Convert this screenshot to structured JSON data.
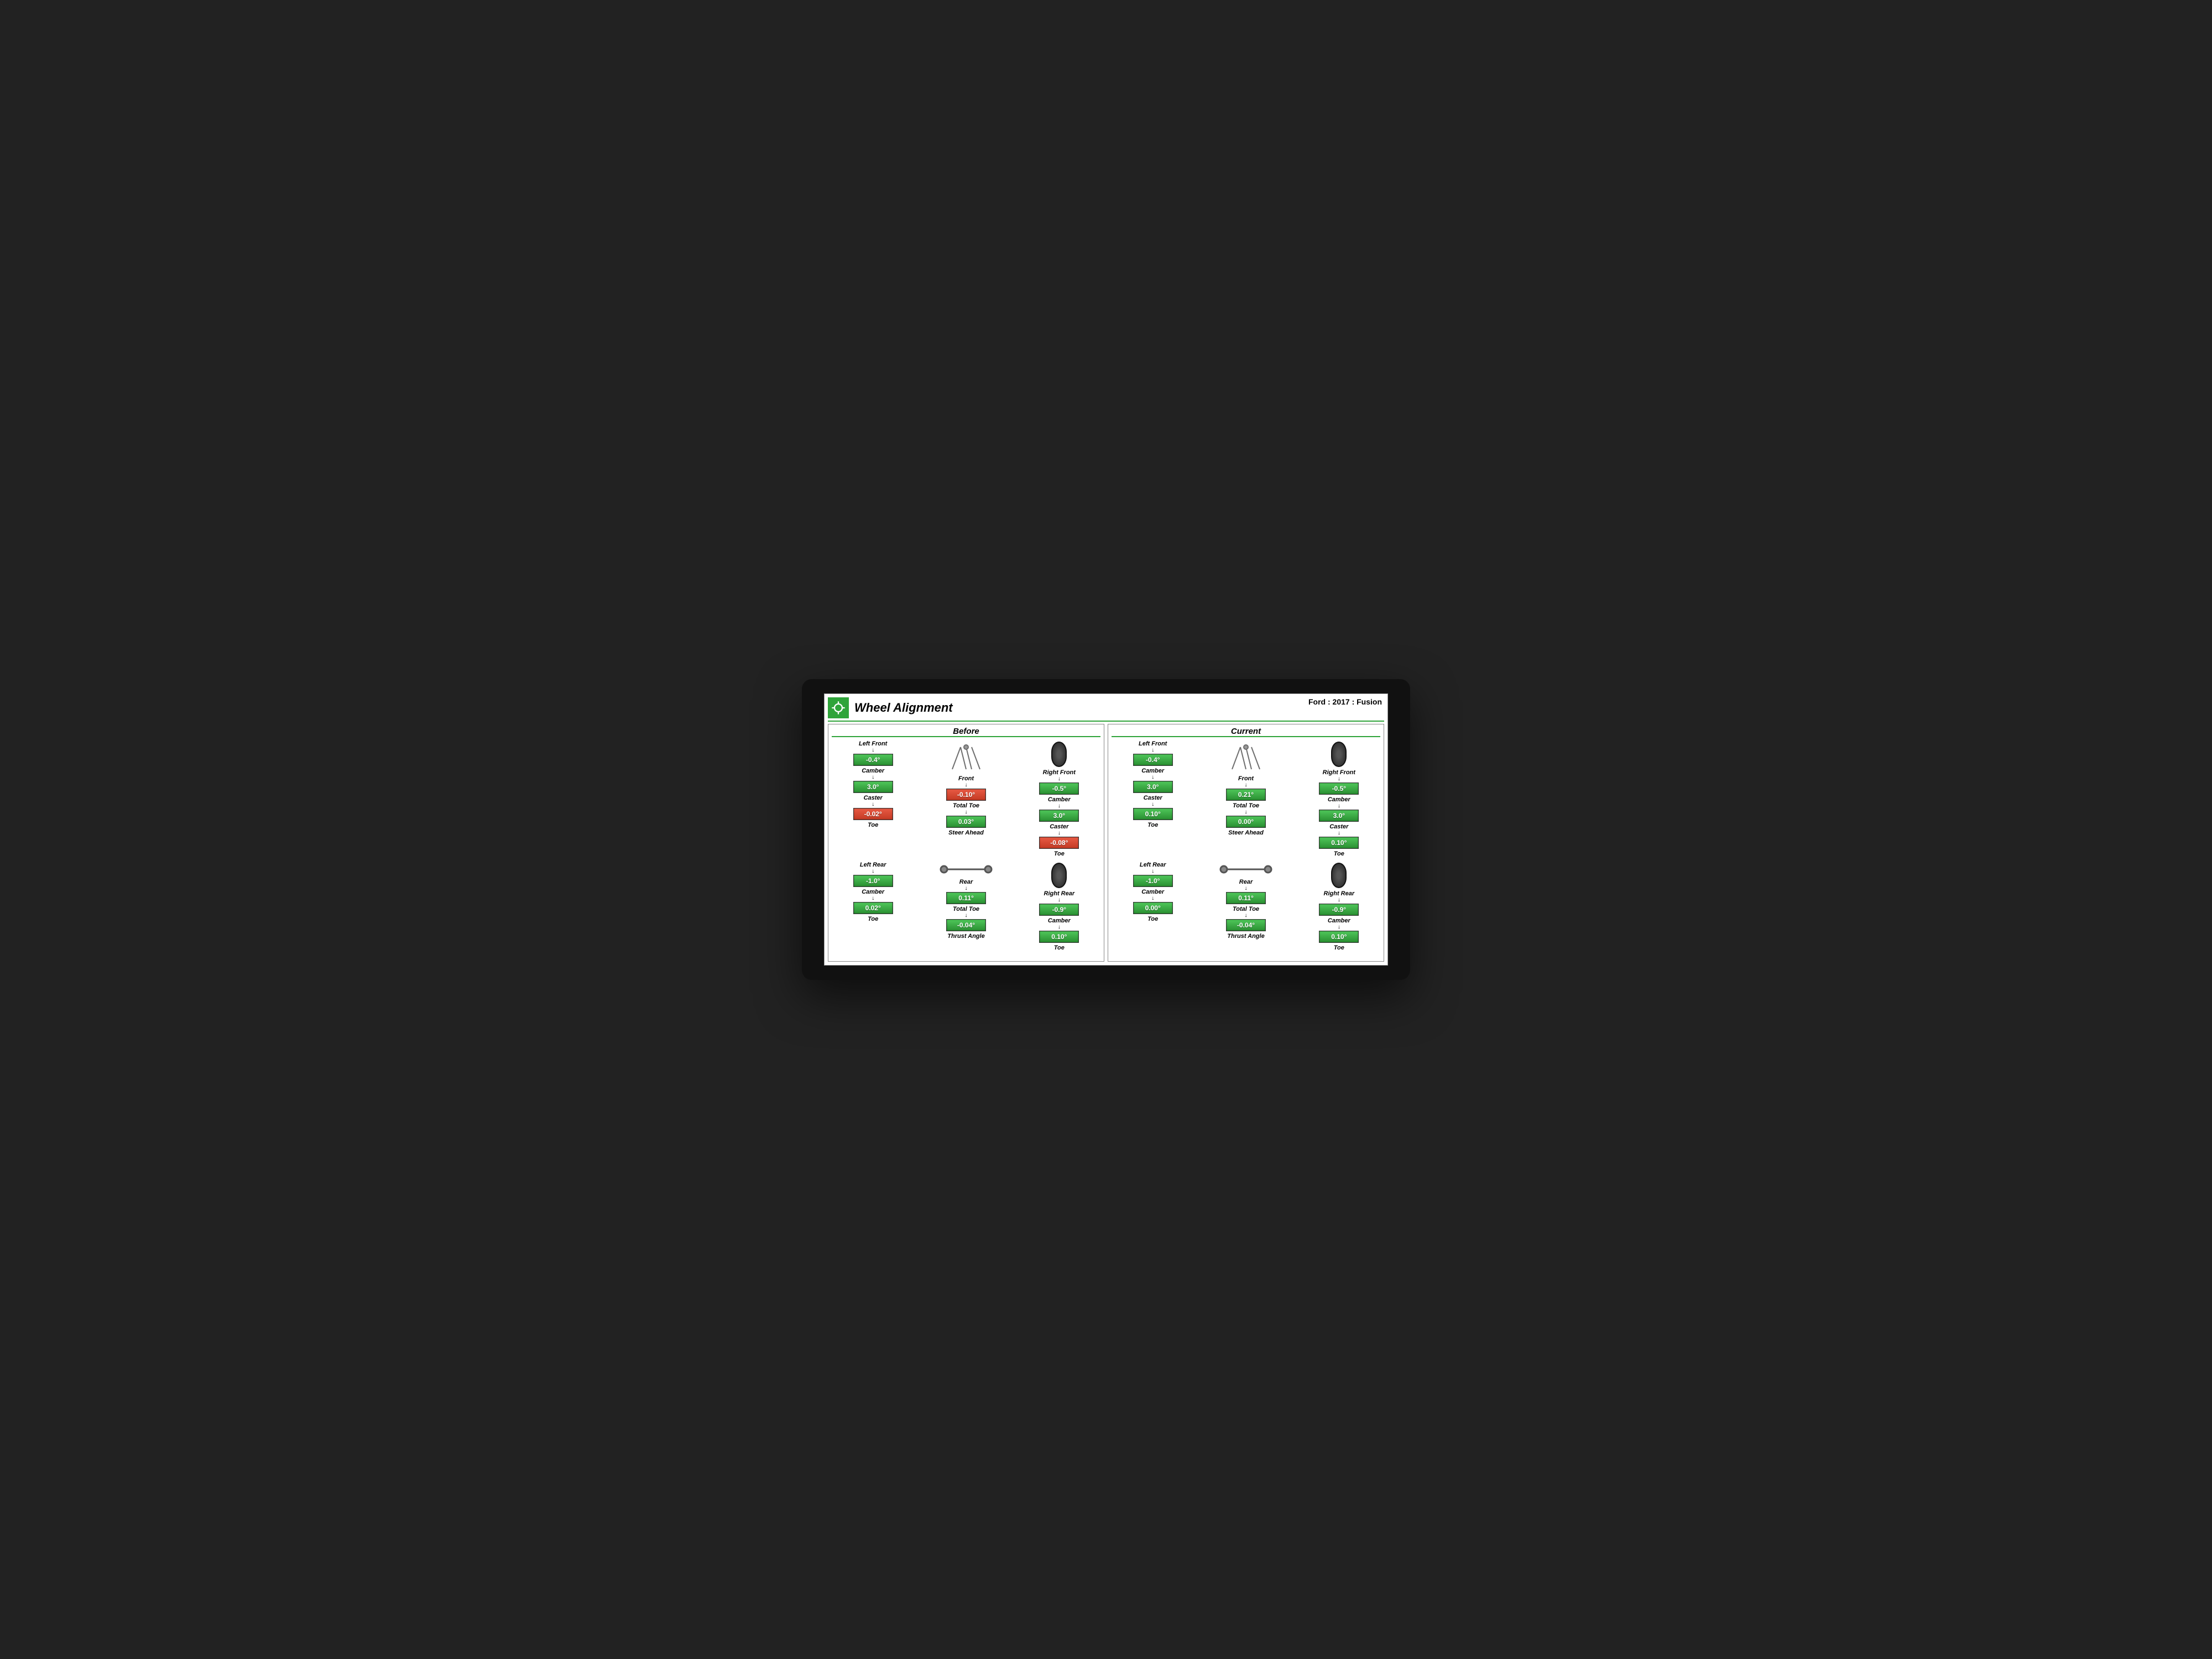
{
  "header": {
    "title": "Wheel Alignment",
    "vehicle": "Ford : 2017 : Fusion"
  },
  "labels": {
    "camber": "Camber",
    "caster": "Caster",
    "toe": "Toe",
    "totalToe": "Total Toe",
    "steerAhead": "Steer Ahead",
    "thrustAngle": "Thrust Angle",
    "front": "Front",
    "rear": "Rear"
  },
  "panels": {
    "before": {
      "title": "Before",
      "front": {
        "left": {
          "pos": "Left Front",
          "camber": "-0.4°",
          "caster": "3.0°",
          "toe": "-0.02°",
          "toeBad": true
        },
        "right": {
          "pos": "Right Front",
          "camber": "-0.5°",
          "caster": "3.0°",
          "toe": "-0.08°",
          "toeBad": true
        },
        "center": {
          "totalToe": "-0.10°",
          "totalToeBad": true,
          "steerAhead": "0.03°"
        }
      },
      "rear": {
        "left": {
          "pos": "Left Rear",
          "camber": "-1.0°",
          "toe": "0.02°"
        },
        "right": {
          "pos": "Right Rear",
          "camber": "-0.9°",
          "toe": "0.10°"
        },
        "center": {
          "totalToe": "0.11°",
          "thrustAngle": "-0.04°"
        }
      }
    },
    "current": {
      "title": "Current",
      "front": {
        "left": {
          "pos": "Left Front",
          "camber": "-0.4°",
          "caster": "3.0°",
          "toe": "0.10°"
        },
        "right": {
          "pos": "Right Front",
          "camber": "-0.5°",
          "caster": "3.0°",
          "toe": "0.10°"
        },
        "center": {
          "totalToe": "0.21°",
          "steerAhead": "0.00°"
        }
      },
      "rear": {
        "left": {
          "pos": "Left Rear",
          "camber": "-1.0°",
          "toe": "0.00°"
        },
        "right": {
          "pos": "Right Rear",
          "camber": "-0.9°",
          "toe": "0.10°"
        },
        "center": {
          "totalToe": "0.11°",
          "thrustAngle": "-0.04°"
        }
      }
    }
  }
}
